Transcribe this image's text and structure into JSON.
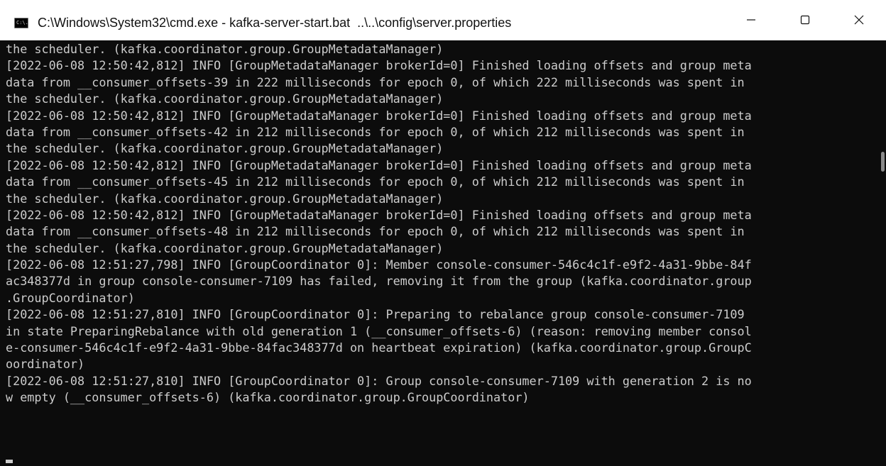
{
  "titlebar": {
    "title": "C:\\Windows\\System32\\cmd.exe - kafka-server-start.bat  ..\\..\\config\\server.properties",
    "icon": "cmd-icon",
    "icon_glyph": "C:\\.",
    "minimize_icon": "minimize-icon",
    "maximize_icon": "maximize-icon",
    "close_icon": "close-icon"
  },
  "console": {
    "lines": [
      "the scheduler. (kafka.coordinator.group.GroupMetadataManager)",
      "[2022-06-08 12:50:42,812] INFO [GroupMetadataManager brokerId=0] Finished loading offsets and group meta",
      "data from __consumer_offsets-39 in 222 milliseconds for epoch 0, of which 222 milliseconds was spent in",
      "the scheduler. (kafka.coordinator.group.GroupMetadataManager)",
      "[2022-06-08 12:50:42,812] INFO [GroupMetadataManager brokerId=0] Finished loading offsets and group meta",
      "data from __consumer_offsets-42 in 212 milliseconds for epoch 0, of which 212 milliseconds was spent in",
      "the scheduler. (kafka.coordinator.group.GroupMetadataManager)",
      "[2022-06-08 12:50:42,812] INFO [GroupMetadataManager brokerId=0] Finished loading offsets and group meta",
      "data from __consumer_offsets-45 in 212 milliseconds for epoch 0, of which 212 milliseconds was spent in",
      "the scheduler. (kafka.coordinator.group.GroupMetadataManager)",
      "[2022-06-08 12:50:42,812] INFO [GroupMetadataManager brokerId=0] Finished loading offsets and group meta",
      "data from __consumer_offsets-48 in 212 milliseconds for epoch 0, of which 212 milliseconds was spent in",
      "the scheduler. (kafka.coordinator.group.GroupMetadataManager)",
      "[2022-06-08 12:51:27,798] INFO [GroupCoordinator 0]: Member console-consumer-546c4c1f-e9f2-4a31-9bbe-84f",
      "ac348377d in group console-consumer-7109 has failed, removing it from the group (kafka.coordinator.group",
      ".GroupCoordinator)",
      "[2022-06-08 12:51:27,810] INFO [GroupCoordinator 0]: Preparing to rebalance group console-consumer-7109",
      "in state PreparingRebalance with old generation 1 (__consumer_offsets-6) (reason: removing member consol",
      "e-consumer-546c4c1f-e9f2-4a31-9bbe-84fac348377d on heartbeat expiration) (kafka.coordinator.group.GroupC",
      "oordinator)",
      "[2022-06-08 12:51:27,810] INFO [GroupCoordinator 0]: Group console-consumer-7109 with generation 2 is no",
      "w empty (__consumer_offsets-6) (kafka.coordinator.group.GroupCoordinator)",
      "",
      ""
    ]
  },
  "colors": {
    "console_bg": "#0c0c0c",
    "console_fg": "#cccccc",
    "titlebar_bg": "#ffffff"
  }
}
